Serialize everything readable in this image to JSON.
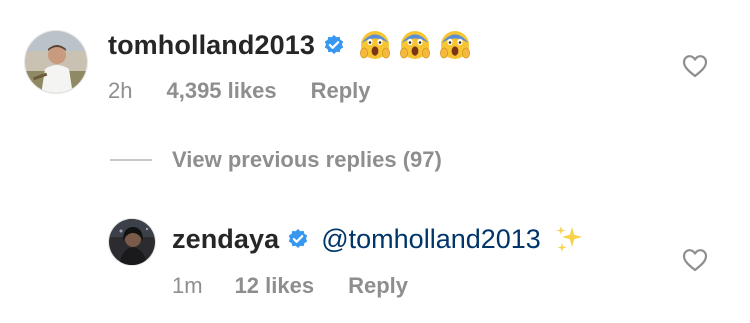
{
  "comment": {
    "username": "tomholland2013",
    "verified": true,
    "text_emojis": [
      "screaming-face-emoji",
      "screaming-face-emoji",
      "screaming-face-emoji"
    ],
    "time": "2h",
    "likes": "4,395 likes",
    "reply_label": "Reply"
  },
  "view_replies": {
    "label": "View previous replies (97)"
  },
  "reply": {
    "username": "zendaya",
    "verified": true,
    "mention": "@tomholland2013",
    "trailing_emoji": "sparkles-emoji",
    "time": "1m",
    "likes": "12 likes",
    "reply_label": "Reply"
  },
  "colors": {
    "verified_blue": "#3897f0",
    "secondary_text": "#8e8e8e",
    "mention_link": "#003569",
    "primary_text": "#262626"
  },
  "icons": {
    "like": "heart-outline-icon",
    "verified": "verified-badge-icon"
  }
}
